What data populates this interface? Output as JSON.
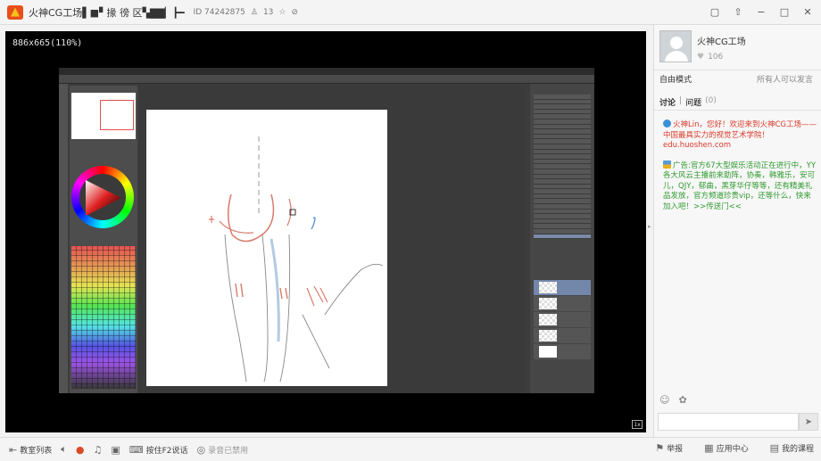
{
  "window": {
    "title": "火神CG工场▌■▘掾 徬 区▚▇▇▏┣━",
    "room_id": "ID 74242875",
    "viewers": "13",
    "controls": [
      "▢",
      "⌂",
      "‒",
      "▢",
      "✕"
    ]
  },
  "video": {
    "resolution": "886x665(110%)",
    "fullscreen_label": "1x"
  },
  "sidebar": {
    "host_name": "火神CG工场",
    "likes": "106",
    "mode": "自由模式",
    "permission": "所有人可以发言",
    "tabs": [
      "讨论",
      "|",
      "问题",
      "(0)"
    ],
    "messages": [
      {
        "text": "火神Lin，您好！欢迎来到火神CG工场——中国最具实力的视觉艺术学院！edu.huoshen.com",
        "color": "red"
      },
      {
        "text": "广告:官方67大型娱乐活动正在进行中，YY各大风云主播前来助阵，协奏，韩雅乐，安可儿，QJY，郁曲，黑芽华仔等等，还有精美礼品发放，官方频道珍贵vip，还等什么，快来加入吧！>>传送门<<",
        "color": "green"
      }
    ],
    "send_icon": "➤"
  },
  "statusbar": {
    "course_list": "教室列表",
    "press_f2": "按住F2说话",
    "recording": "录音已禁用",
    "report": "举报",
    "app_center": "应用中心",
    "my_courses": "我的课程"
  }
}
